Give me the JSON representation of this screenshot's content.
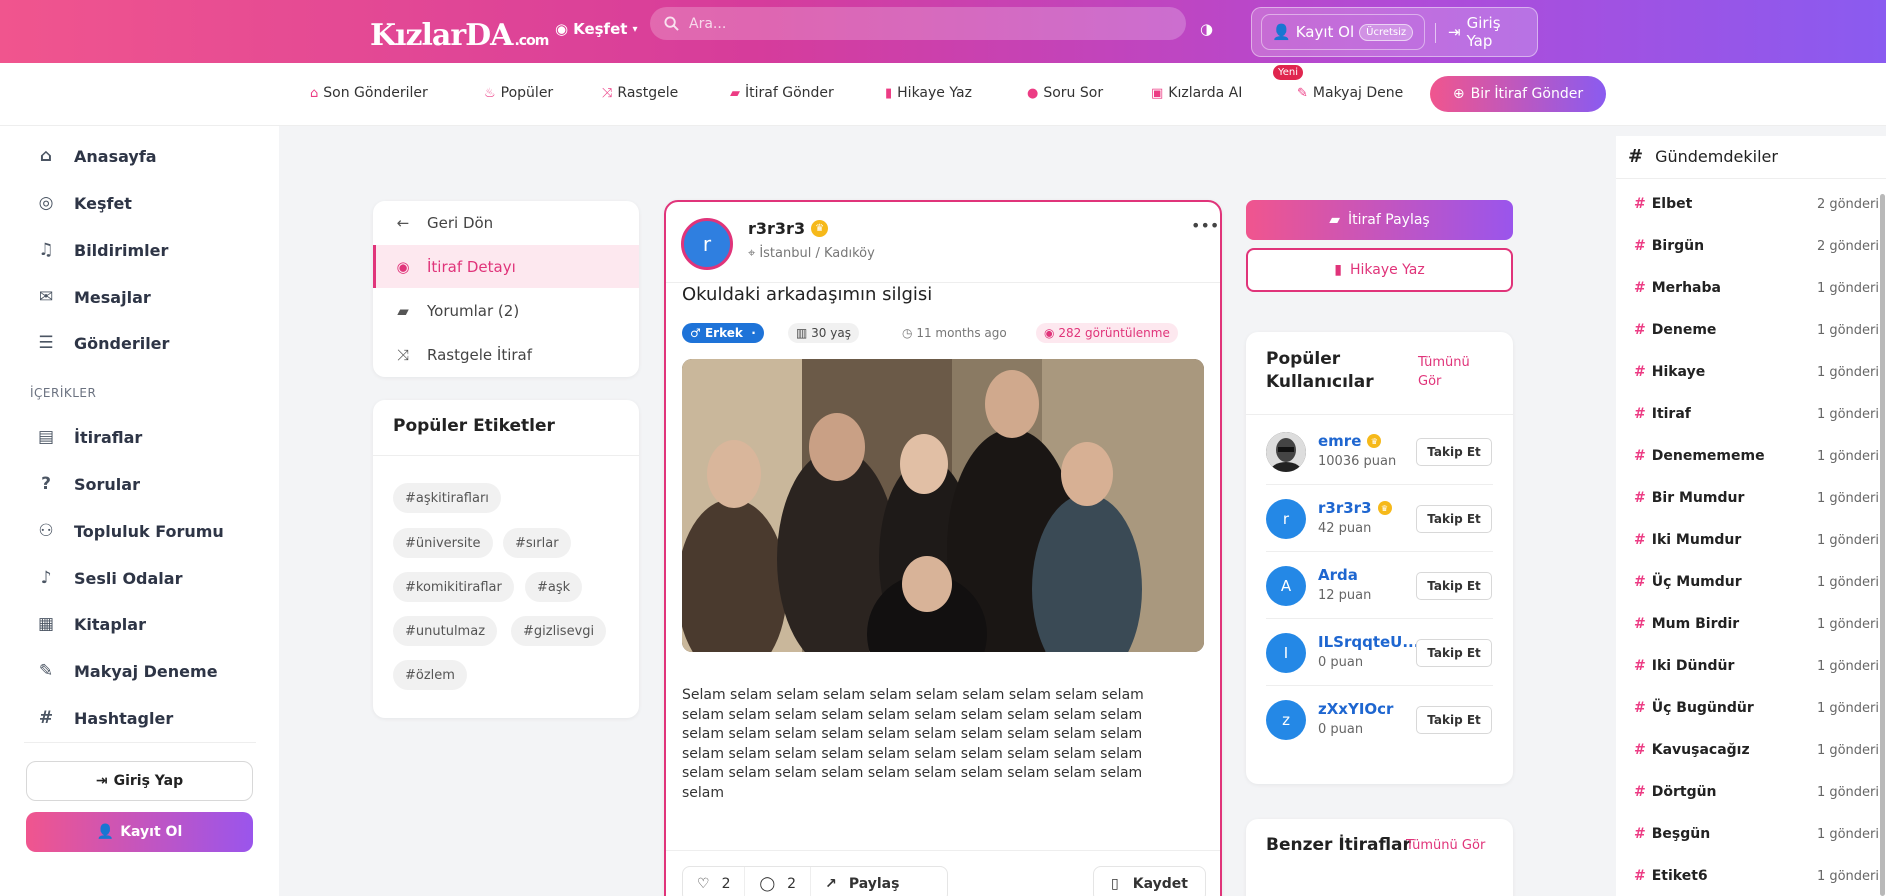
{
  "header": {
    "logo_text": "KızlarDA",
    "logo_suffix": ".com",
    "explore_label": "Keşfet",
    "search_placeholder": "Ara...",
    "register_label": "Kayıt Ol",
    "free_badge": "Ücretsiz",
    "login_label": "Giriş Yap"
  },
  "nav": {
    "items": [
      {
        "label": "Son Gönderiler",
        "icon": "home-icon"
      },
      {
        "label": "Popüler",
        "icon": "fire-icon"
      },
      {
        "label": "Rastgele",
        "icon": "shuffle-icon"
      },
      {
        "label": "İtiraf Gönder",
        "icon": "comment-icon"
      },
      {
        "label": "Hikaye Yaz",
        "icon": "book-icon"
      },
      {
        "label": "Soru Sor",
        "icon": "question-icon"
      },
      {
        "label": "Kızlarda AI",
        "icon": "robot-icon"
      },
      {
        "label": "Makyaj Dene",
        "icon": "brush-icon"
      }
    ],
    "new_badge": "Yeni",
    "cta_label": "Bir İtiraf Gönder"
  },
  "sidebar": {
    "items": [
      {
        "label": "Anasayfa",
        "icon": "home-icon"
      },
      {
        "label": "Keşfet",
        "icon": "compass-icon"
      },
      {
        "label": "Bildirimler",
        "icon": "bell-icon"
      },
      {
        "label": "Mesajlar",
        "icon": "envelope-icon"
      },
      {
        "label": "Gönderiler",
        "icon": "list-icon"
      }
    ],
    "section_label": "İÇERİKLER",
    "content_items": [
      {
        "label": "İtiraflar",
        "icon": "book-icon"
      },
      {
        "label": "Sorular",
        "icon": "question-icon"
      },
      {
        "label": "Topluluk Forumu",
        "icon": "users-icon"
      },
      {
        "label": "Sesli Odalar",
        "icon": "microphone-icon"
      },
      {
        "label": "Kitaplar",
        "icon": "open-book-icon"
      },
      {
        "label": "Makyaj Deneme",
        "icon": "pencil-icon"
      },
      {
        "label": "Hashtagler",
        "icon": "hashtag-icon"
      }
    ],
    "login_label": "Giriş Yap",
    "register_label": "Kayıt Ol"
  },
  "detail_nav": {
    "items": [
      {
        "label": "Geri Dön",
        "icon": "arrow-left-icon"
      },
      {
        "label": "İtiraf Detayı",
        "icon": "eye-icon"
      },
      {
        "label": "Yorumlar (2)",
        "icon": "comments-icon"
      },
      {
        "label": "Rastgele İtiraf",
        "icon": "shuffle-icon"
      }
    ]
  },
  "popular_tags": {
    "title": "Popüler Etiketler",
    "tags": [
      "#aşkitirafları",
      "#üniversite",
      "#sırlar",
      "#komikitiraflar",
      "#aşk",
      "#unutulmaz",
      "#gizlisevgi",
      "#özlem"
    ]
  },
  "post": {
    "avatar_letter": "r",
    "username": "r3r3r3",
    "location": "İstanbul / Kadıköy",
    "title": "Okuldaki arkadaşımın silgisi",
    "gender": "Erkek",
    "age": "30 yaş",
    "time": "11 months ago",
    "views": "282 görüntülenme",
    "body": "Selam selam selam selam selam selam selam selam selam selam selam selam selam selam selam selam selam selam selam selam selam selam selam selam selam selam selam selam selam selam selam selam selam selam selam selam selam selam selam selam selam selam selam selam selam selam selam selam selam selam selam",
    "likes": "2",
    "comments": "2",
    "share_label": "Paylaş",
    "save_label": "Kaydet"
  },
  "actions": {
    "share_confession": "İtiraf Paylaş",
    "write_story": "Hikaye Yaz"
  },
  "popular_users": {
    "title": "Popüler Kullanıcılar",
    "see_all": "Tümünü Gör",
    "follow_label": "Takip Et",
    "users": [
      {
        "name": "emre",
        "points": "10036 puan",
        "avatar": "",
        "crown": true
      },
      {
        "name": "r3r3r3",
        "points": "42 puan",
        "avatar": "r",
        "crown": true
      },
      {
        "name": "Arda",
        "points": "12 puan",
        "avatar": "A",
        "crown": false
      },
      {
        "name": "ILSrqqteU...",
        "points": "0 puan",
        "avatar": "I",
        "crown": false
      },
      {
        "name": "zXxYIOcr",
        "points": "0 puan",
        "avatar": "z",
        "crown": false
      }
    ]
  },
  "similar": {
    "title": "Benzer İtiraflar",
    "see_all": "Tümünü Gör"
  },
  "trending": {
    "title": "Gündemdekiler",
    "items": [
      {
        "name": "Elbet",
        "count": "2 gönderi"
      },
      {
        "name": "Birgün",
        "count": "2 gönderi"
      },
      {
        "name": "Merhaba",
        "count": "1 gönderi"
      },
      {
        "name": "Deneme",
        "count": "1 gönderi"
      },
      {
        "name": "Hikaye",
        "count": "1 gönderi"
      },
      {
        "name": "Itiraf",
        "count": "1 gönderi"
      },
      {
        "name": "Denemememe",
        "count": "1 gönderi"
      },
      {
        "name": "Bir Mumdur",
        "count": "1 gönderi"
      },
      {
        "name": "Iki Mumdur",
        "count": "1 gönderi"
      },
      {
        "name": "Üç Mumdur",
        "count": "1 gönderi"
      },
      {
        "name": "Mum Birdir",
        "count": "1 gönderi"
      },
      {
        "name": "Iki Dündür",
        "count": "1 gönderi"
      },
      {
        "name": "Üç Bugündür",
        "count": "1 gönderi"
      },
      {
        "name": "Kavuşacağız",
        "count": "1 gönderi"
      },
      {
        "name": "Dörtgün",
        "count": "1 gönderi"
      },
      {
        "name": "Beşgün",
        "count": "1 gönderi"
      },
      {
        "name": "Etiket6",
        "count": "1 gönderi"
      }
    ]
  },
  "colors": {
    "brand_pink": "#f0558e",
    "brand_purple": "#8a5bf0",
    "accent": "#e0347a",
    "link_blue": "#1e66d0"
  }
}
